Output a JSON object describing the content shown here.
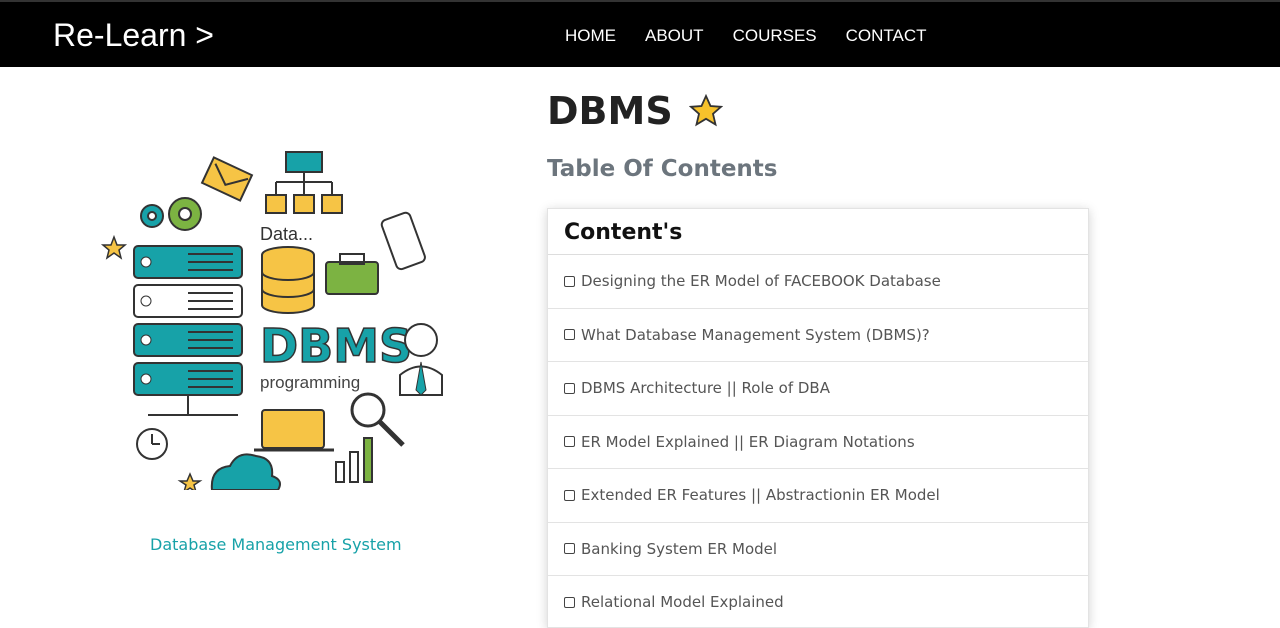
{
  "brand": "Re-Learn >",
  "nav": [
    "HOME",
    "ABOUT",
    "COURSES",
    "CONTACT"
  ],
  "hero": {
    "image_alt_texts": [
      "Data...",
      "DBMS",
      "programming"
    ],
    "caption": "Database Management System"
  },
  "page": {
    "title": "DBMS",
    "subtitle": "Table Of Contents"
  },
  "contents": {
    "header": "Content's",
    "items": [
      "Designing the ER Model of FACEBOOK Database",
      "What Database Management System (DBMS)?",
      "DBMS Architecture || Role of DBA",
      "ER Model Explained || ER Diagram Notations",
      "Extended ER Features || Abstractionin ER Model",
      "Banking System ER Model",
      "Relational Model Explained"
    ]
  },
  "colors": {
    "navbar": "#000000",
    "accent": "#17a2a8",
    "muted": "#6c757d"
  }
}
